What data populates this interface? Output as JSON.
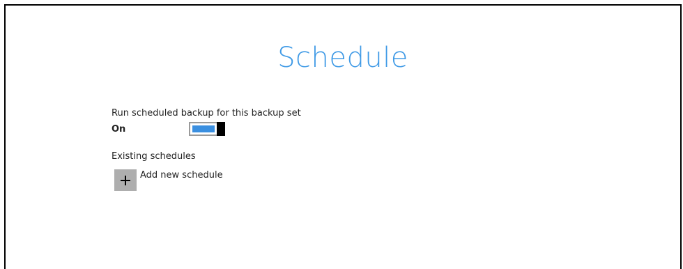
{
  "page": {
    "title": "Schedule"
  },
  "scheduled_backup": {
    "label": "Run scheduled backup for this backup set",
    "state": "On",
    "enabled": true
  },
  "existing_schedules": {
    "label": "Existing schedules",
    "add_label": "Add new schedule",
    "add_icon": "plus-icon"
  },
  "colors": {
    "title": "#3f9ae6",
    "toggle_fill": "#3a8fe0",
    "add_button_bg": "#aeaeae"
  }
}
